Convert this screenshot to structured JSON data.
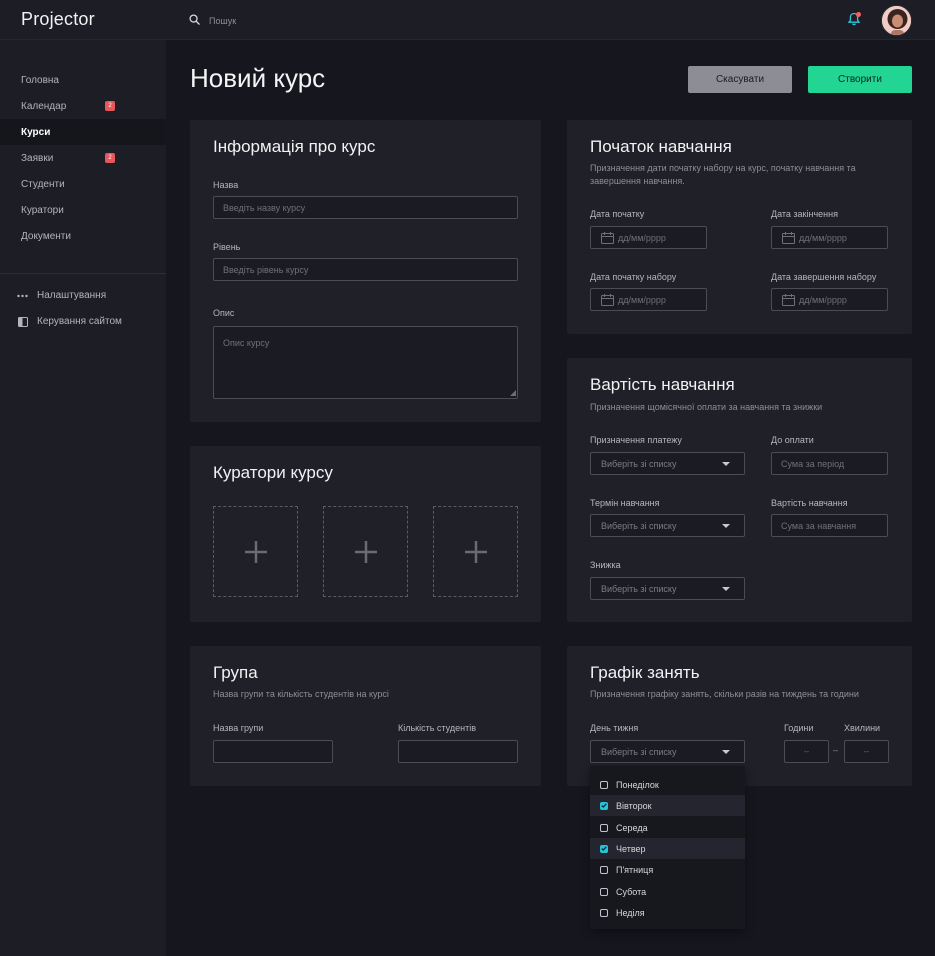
{
  "app": {
    "logo": "Projector"
  },
  "search": {
    "placeholder": "Пошук"
  },
  "sidebar": {
    "items": [
      {
        "label": "Головна"
      },
      {
        "label": "Календар",
        "badge": "2"
      },
      {
        "label": "Курси"
      },
      {
        "label": "Заявки",
        "badge": "2"
      },
      {
        "label": "Студенти"
      },
      {
        "label": "Куратори"
      },
      {
        "label": "Документи"
      }
    ],
    "active": "Курси",
    "tools": [
      {
        "label": "Налаштування",
        "icon": "dots-icon"
      },
      {
        "label": "Керування сайтом",
        "icon": "site-panel-icon"
      }
    ]
  },
  "page": {
    "title": "Новий курс"
  },
  "actions": {
    "cancel_label": "Скасувати",
    "create_label": "Створити"
  },
  "course_info": {
    "title": "Інформація про курс",
    "name_label": "Назва",
    "name_placeholder": "Введіть назву курсу",
    "level_label": "Рівень",
    "level_placeholder": "Введіть рівень курсу",
    "description_label": "Опис",
    "description_placeholder": "Опис курсу"
  },
  "curators": {
    "title": "Куратори курсу",
    "add_icon": "plus-icon"
  },
  "group": {
    "title": "Група",
    "subtitle": "Назва групи та кількість студентів на курсі",
    "name_label": "Назва групи",
    "count_label": "Кількість студентів"
  },
  "start": {
    "title": "Початок навчання",
    "subtitle": "Призначення дати початку набору на курс, початку навчання та завершення навчання.",
    "start_date_label": "Дата початку",
    "end_date_label": "Дата закінчення",
    "enroll_start_label": "Дата початку набору",
    "enroll_end_label": "Дата завершення набору",
    "date_placeholder": "дд/мм/рррр"
  },
  "cost": {
    "title": "Вартість навчання",
    "subtitle": "Призначення  щомісячної оплати за навчання та знижки",
    "payment_label": "Призначення платежу",
    "due_label": "До оплати",
    "due_placeholder": "Сума за період",
    "term_label": "Термін навчання",
    "price_label": "Вартість навчання",
    "price_placeholder": "Сума за навчання",
    "discount_label": "Знижка",
    "select_placeholder": "Виберіть зі списку"
  },
  "schedule": {
    "title": "Графік занять",
    "subtitle": "Призначення  графіку занять, скільки разів на тиждень та години",
    "day_label": "День тижня",
    "day_placeholder": "Виберіть зі списку",
    "hours_label": "Години",
    "minutes_label": "Хвилини",
    "time_placeholder": "--",
    "separator": "–",
    "days": [
      {
        "label": "Понеділок",
        "checked": false
      },
      {
        "label": "Вівторок",
        "checked": true
      },
      {
        "label": "Середа",
        "checked": false
      },
      {
        "label": "Четвер",
        "checked": true
      },
      {
        "label": "П'ятниця",
        "checked": false
      },
      {
        "label": "Субота",
        "checked": false
      },
      {
        "label": "Неділя",
        "checked": false
      }
    ]
  },
  "colors": {
    "accent": "#22d592",
    "badge": "#e5575a",
    "check": "#27c4d8"
  }
}
